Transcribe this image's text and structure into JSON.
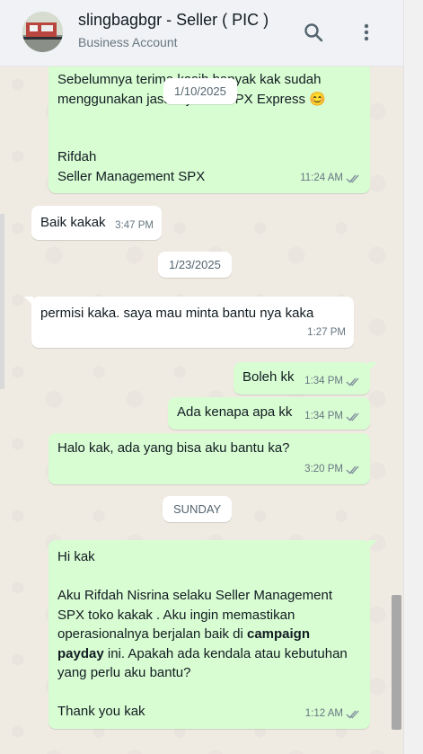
{
  "header": {
    "title": "slingbagbgr - Seller ( PIC )",
    "subtitle": "Business Account",
    "search_icon": "search-icon",
    "menu_icon": "kebab-menu-icon"
  },
  "messages": {
    "m1_line1": "Sebelumnya terima kasih banyak kak sudah",
    "m1_line2": "menggunakan jasa layanan SPX Express 😊",
    "m1_line3": "Rifdah",
    "m1_line4": "Seller Management SPX",
    "m1_time": "11:24 AM",
    "m2_text": "Baik kakak",
    "m2_time": "3:47 PM",
    "m3_text": "permisi kaka. saya mau minta bantu nya kaka",
    "m3_time": "1:27 PM",
    "m4_text": "Boleh kk",
    "m4_time": "1:34 PM",
    "m5_text": "Ada kenapa apa kk",
    "m5_time": "1:34 PM",
    "m6_text": "Halo kak, ada yang bisa aku bantu ka?",
    "m6_time": "3:20 PM",
    "m7_l1": "Hi kak",
    "m7_l2": "Aku Rifdah Nisrina selaku Seller Management",
    "m7_l3": "SPX toko kakak . Aku ingin memastikan",
    "m7_l4a": "operasionalnya berjalan baik di ",
    "m7_l4b": "campaign",
    "m7_l5a": "payday",
    "m7_l5b": " ini. Apakah ada kendala atau kebutuhan",
    "m7_l6": "yang perlu aku bantu?",
    "m7_l7": "Thank you kak",
    "m7_time": "1:12 AM"
  },
  "dates": {
    "d1": "1/10/2025",
    "d2": "1/23/2025",
    "d3": "SUNDAY"
  },
  "colors": {
    "outgoing": "#d9fdd3",
    "incoming": "#ffffff",
    "read_ticks": "#8696a0"
  }
}
